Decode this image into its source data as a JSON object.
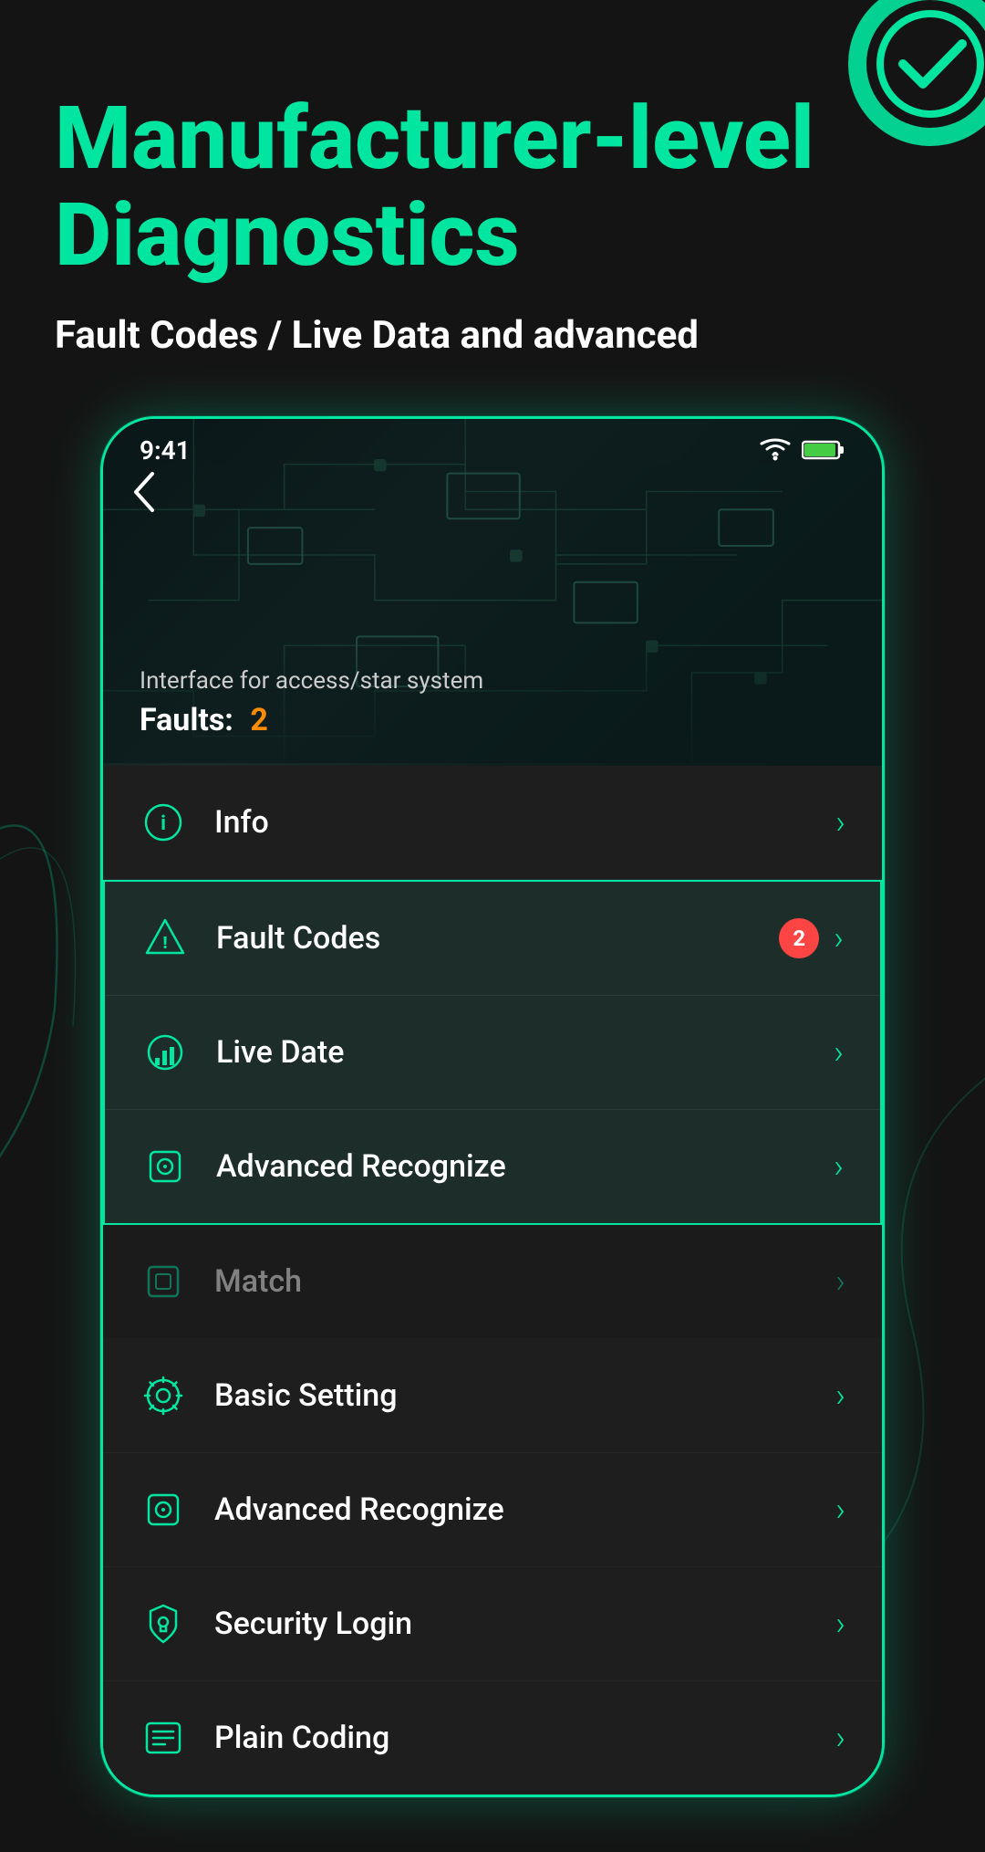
{
  "page": {
    "background_color": "#141414",
    "accent_color": "#00e5a0"
  },
  "header": {
    "main_title": "Manufacturer-level Diagnostics",
    "subtitle": "Fault Codes / Live Data and advanced"
  },
  "phone": {
    "status_bar": {
      "time": "9:41",
      "wifi_icon": "wifi",
      "battery_icon": "battery"
    },
    "hero": {
      "back_button": "‹",
      "interface_label": "Interface for access/star system",
      "faults_label": "Faults:",
      "faults_count": "2",
      "faults_count_color": "#ff8c00"
    },
    "menu_items": [
      {
        "id": "info",
        "icon": "ℹ",
        "label": "Info",
        "badge": null,
        "highlighted": false,
        "dimmed": false,
        "show_arrow": true
      },
      {
        "id": "fault-codes",
        "icon": "⚠",
        "label": "Fault Codes",
        "badge": "2",
        "highlighted": true,
        "dimmed": false,
        "show_arrow": true
      },
      {
        "id": "live-date",
        "icon": "📊",
        "label": "Live Date",
        "badge": null,
        "highlighted": true,
        "dimmed": false,
        "show_arrow": true
      },
      {
        "id": "advanced-recognize-1",
        "icon": "🔍",
        "label": "Advanced Recognize",
        "badge": null,
        "highlighted": true,
        "dimmed": false,
        "show_arrow": true
      },
      {
        "id": "match",
        "icon": "🔲",
        "label": "Match",
        "badge": null,
        "highlighted": false,
        "dimmed": true,
        "show_arrow": true
      },
      {
        "id": "basic-setting",
        "icon": "⚙",
        "label": "Basic Setting",
        "badge": null,
        "highlighted": false,
        "dimmed": false,
        "show_arrow": true
      },
      {
        "id": "advanced-recognize-2",
        "icon": "🔍",
        "label": "Advanced Recognize",
        "badge": null,
        "highlighted": false,
        "dimmed": false,
        "show_arrow": true
      },
      {
        "id": "security-login",
        "icon": "🔒",
        "label": "Security Login",
        "badge": null,
        "highlighted": false,
        "dimmed": false,
        "show_arrow": true
      },
      {
        "id": "plain-coding",
        "icon": "📋",
        "label": "Plain Coding",
        "badge": null,
        "highlighted": false,
        "dimmed": false,
        "show_arrow": true
      }
    ]
  }
}
